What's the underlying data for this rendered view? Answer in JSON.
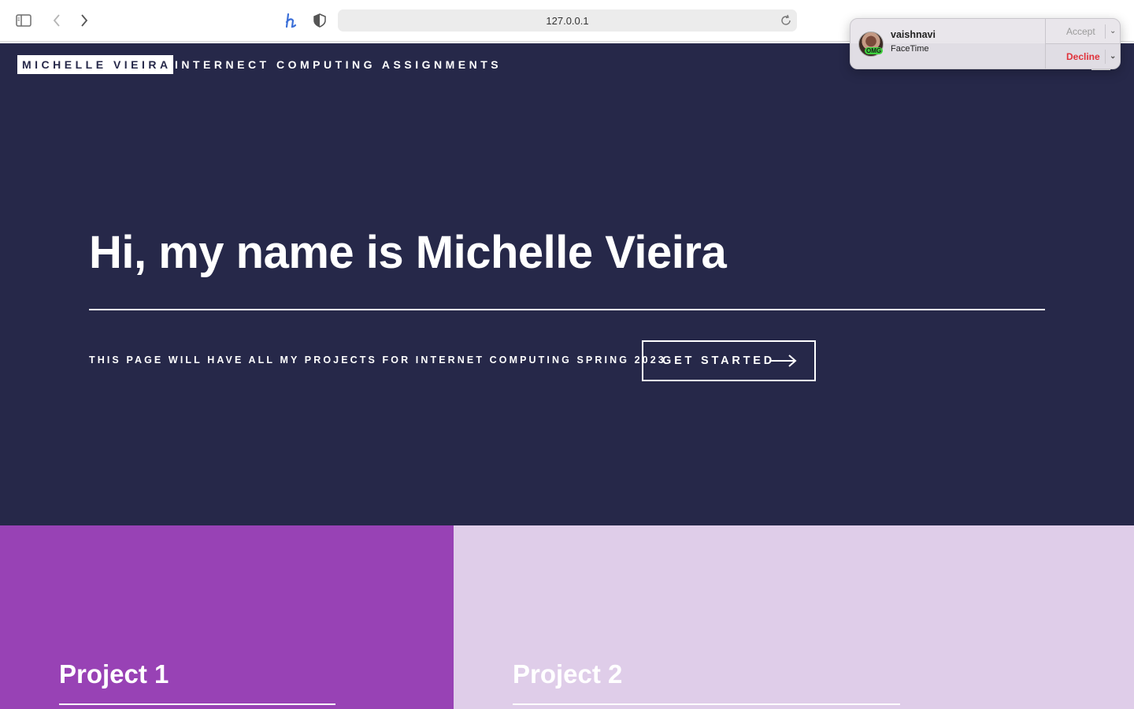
{
  "browser": {
    "address": "127.0.0.1"
  },
  "site": {
    "brand": "MICHELLE VIEIRA",
    "brand_sub": "INTERNECT COMPUTING ASSIGNMENTS",
    "hero_title": "Hi, my name is Michelle Vieira",
    "hero_desc": "THIS PAGE WILL HAVE ALL MY PROJECTS FOR INTERNET COMPUTING SPRING 2023",
    "cta_label": "GET STARTED",
    "projects": [
      {
        "title": "Project 1",
        "color": "#9842b5"
      },
      {
        "title": "Project 2",
        "color": "#dfcde9"
      }
    ],
    "hero_bg": "#262849"
  },
  "notification": {
    "caller": "vaishnavi",
    "app": "FaceTime",
    "badge": "OMG",
    "accept_label": "Accept",
    "decline_label": "Decline",
    "decline_color": "#e0323b"
  }
}
